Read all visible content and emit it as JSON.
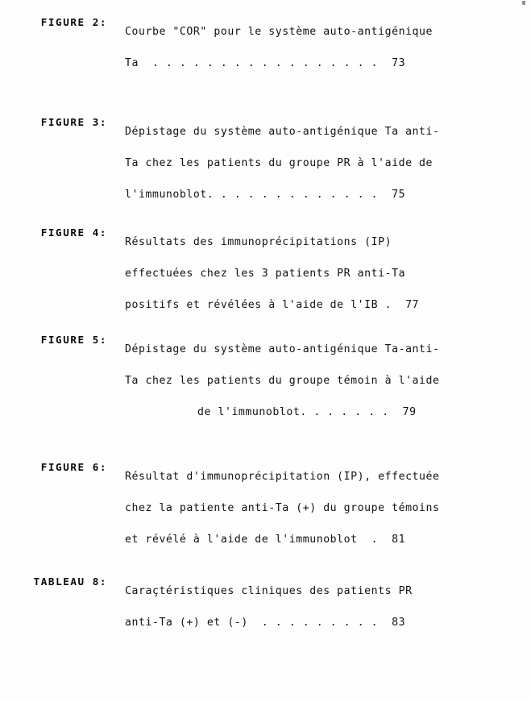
{
  "document": {
    "kind": "list-of-figures-and-tables",
    "language": "fr",
    "page_background": "#fefefe",
    "text_color": "#121212"
  },
  "entries": [
    {
      "label": "FIGURE 2:",
      "lines": [
        "Courbe \"COR\" pour le système auto-antigénique",
        "Ta  . . . . . . . . . . . . . . . . .  73"
      ],
      "page_number": "73",
      "indent_last": false
    },
    {
      "label": "FIGURE 3:",
      "lines": [
        "Dépistage du système auto-antigénique Ta anti-",
        "Ta chez les patients du groupe PR à l'aide de",
        "l'immunoblot. . . . . . . . . . . . .  75"
      ],
      "page_number": "75",
      "indent_last": false
    },
    {
      "label": "FIGURE 4:",
      "lines": [
        "Résultats des immunoprécipitations (IP)",
        "effectuées chez les 3 patients PR anti-Ta",
        "positifs et révélées à l'aide de l'IB .  77"
      ],
      "page_number": "77",
      "indent_last": false
    },
    {
      "label": "FIGURE 5:",
      "lines": [
        "Dépistage du système auto-antigénique Ta-anti-",
        "Ta chez les patients du groupe témoin à l'aide",
        "de l'immunoblot. . . . . . .  79"
      ],
      "page_number": "79",
      "indent_last": true
    },
    {
      "label": "FIGURE 6:",
      "lines": [
        "Résultat d'immunoprécipitation (IP), effectuée",
        "chez la patiente anti-Ta (+) du groupe témoins",
        "et révélé à l'aide de l'immunoblot  .  81"
      ],
      "page_number": "81",
      "indent_last": false
    },
    {
      "label": "TABLEAU 8:",
      "lines": [
        "Caraçtéristiques cliniques des patients PR",
        "anti-Ta (+) et (-)  . . . . . . . . .  83"
      ],
      "page_number": "83",
      "indent_last": false
    }
  ]
}
